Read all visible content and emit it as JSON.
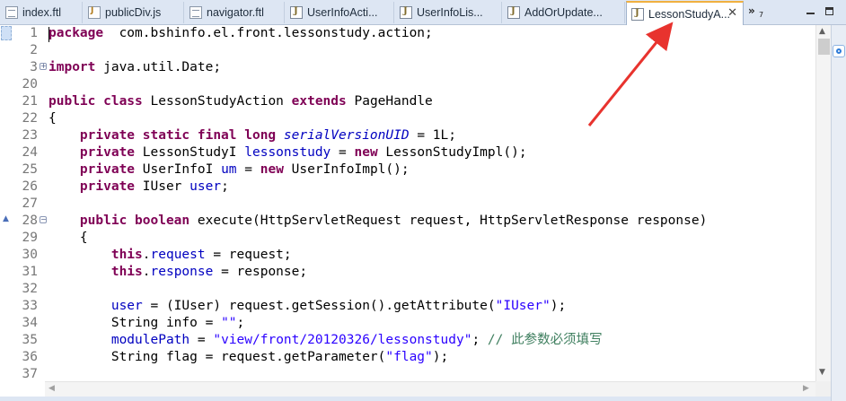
{
  "tabs": [
    {
      "label": "index.ftl",
      "icon": "ftl-file-icon"
    },
    {
      "label": "publicDiv.js",
      "icon": "js-file-icon"
    },
    {
      "label": "navigator.ftl",
      "icon": "ftl-file-icon"
    },
    {
      "label": "UserInfoActi...",
      "icon": "java-file-icon"
    },
    {
      "label": "UserInfoLis...",
      "icon": "java-file-icon"
    },
    {
      "label": "AddOrUpdate...",
      "icon": "java-file-icon"
    },
    {
      "label": "LessonStudyA...",
      "icon": "java-file-icon",
      "active": true
    }
  ],
  "overflow_count": "7",
  "code_lines": [
    {
      "n": "1",
      "tokens": [
        [
          "kw",
          "package"
        ],
        [
          "",
          "  com.bshinfo.el.front.lessonstudy.action;"
        ]
      ]
    },
    {
      "n": "2",
      "tokens": []
    },
    {
      "n": "3",
      "fold": "+",
      "tokens": [
        [
          "kw",
          "import"
        ],
        [
          "",
          " java.util.Date;"
        ]
      ]
    },
    {
      "n": "20",
      "tokens": []
    },
    {
      "n": "21",
      "tokens": [
        [
          "kw",
          "public class"
        ],
        [
          "",
          " LessonStudyAction "
        ],
        [
          "kw",
          "extends"
        ],
        [
          "",
          " PageHandle"
        ]
      ]
    },
    {
      "n": "22",
      "tokens": [
        [
          "",
          "{"
        ]
      ]
    },
    {
      "n": "23",
      "tokens": [
        [
          "",
          "    "
        ],
        [
          "kw",
          "private static final long"
        ],
        [
          "",
          " "
        ],
        [
          "fldi",
          "serialVersionUID"
        ],
        [
          "",
          " = 1L;"
        ]
      ]
    },
    {
      "n": "24",
      "tokens": [
        [
          "",
          "    "
        ],
        [
          "kw",
          "private"
        ],
        [
          "",
          " LessonStudyI "
        ],
        [
          "fld",
          "lessonstudy"
        ],
        [
          "",
          " = "
        ],
        [
          "kw",
          "new"
        ],
        [
          "",
          " LessonStudyImpl();"
        ]
      ]
    },
    {
      "n": "25",
      "tokens": [
        [
          "",
          "    "
        ],
        [
          "kw",
          "private"
        ],
        [
          "",
          " UserInfoI "
        ],
        [
          "fld",
          "um"
        ],
        [
          "",
          " = "
        ],
        [
          "kw",
          "new"
        ],
        [
          "",
          " UserInfoImpl();"
        ]
      ]
    },
    {
      "n": "26",
      "tokens": [
        [
          "",
          "    "
        ],
        [
          "kw",
          "private"
        ],
        [
          "",
          " IUser "
        ],
        [
          "fld",
          "user"
        ],
        [
          "",
          ";"
        ]
      ]
    },
    {
      "n": "27",
      "tokens": []
    },
    {
      "n": "28",
      "fold": "−",
      "tokens": [
        [
          "",
          "    "
        ],
        [
          "kw",
          "public boolean"
        ],
        [
          "",
          " execute(HttpServletRequest request, HttpServletResponse response)"
        ]
      ]
    },
    {
      "n": "29",
      "tokens": [
        [
          "",
          "    {"
        ]
      ]
    },
    {
      "n": "30",
      "tokens": [
        [
          "",
          "        "
        ],
        [
          "kw",
          "this"
        ],
        [
          "",
          "."
        ],
        [
          "fld",
          "request"
        ],
        [
          "",
          " = request;"
        ]
      ]
    },
    {
      "n": "31",
      "tokens": [
        [
          "",
          "        "
        ],
        [
          "kw",
          "this"
        ],
        [
          "",
          "."
        ],
        [
          "fld",
          "response"
        ],
        [
          "",
          " = response;"
        ]
      ]
    },
    {
      "n": "32",
      "tokens": []
    },
    {
      "n": "33",
      "tokens": [
        [
          "",
          "        "
        ],
        [
          "fld",
          "user"
        ],
        [
          "",
          " = (IUser) request.getSession().getAttribute("
        ],
        [
          "str",
          "\"IUser\""
        ],
        [
          "",
          ");"
        ]
      ]
    },
    {
      "n": "34",
      "tokens": [
        [
          "",
          "        String info = "
        ],
        [
          "str",
          "\"\""
        ],
        [
          "",
          ";"
        ]
      ]
    },
    {
      "n": "35",
      "tokens": [
        [
          "",
          "        "
        ],
        [
          "fld",
          "modulePath"
        ],
        [
          "",
          " = "
        ],
        [
          "str",
          "\"view/front/20120326/lessonstudy\""
        ],
        [
          "",
          "; "
        ],
        [
          "cmt",
          "// 此参数必须填写"
        ]
      ]
    },
    {
      "n": "36",
      "tokens": [
        [
          "",
          "        String flag = request.getParameter("
        ],
        [
          "str",
          "\"flag\""
        ],
        [
          "",
          ");"
        ]
      ]
    },
    {
      "n": "37",
      "tokens": []
    }
  ],
  "colors": {
    "keyword": "#7f0055",
    "field": "#0000c0",
    "string": "#2a00ff",
    "comment": "#3f7f5f",
    "arrow": "#e8332e"
  }
}
